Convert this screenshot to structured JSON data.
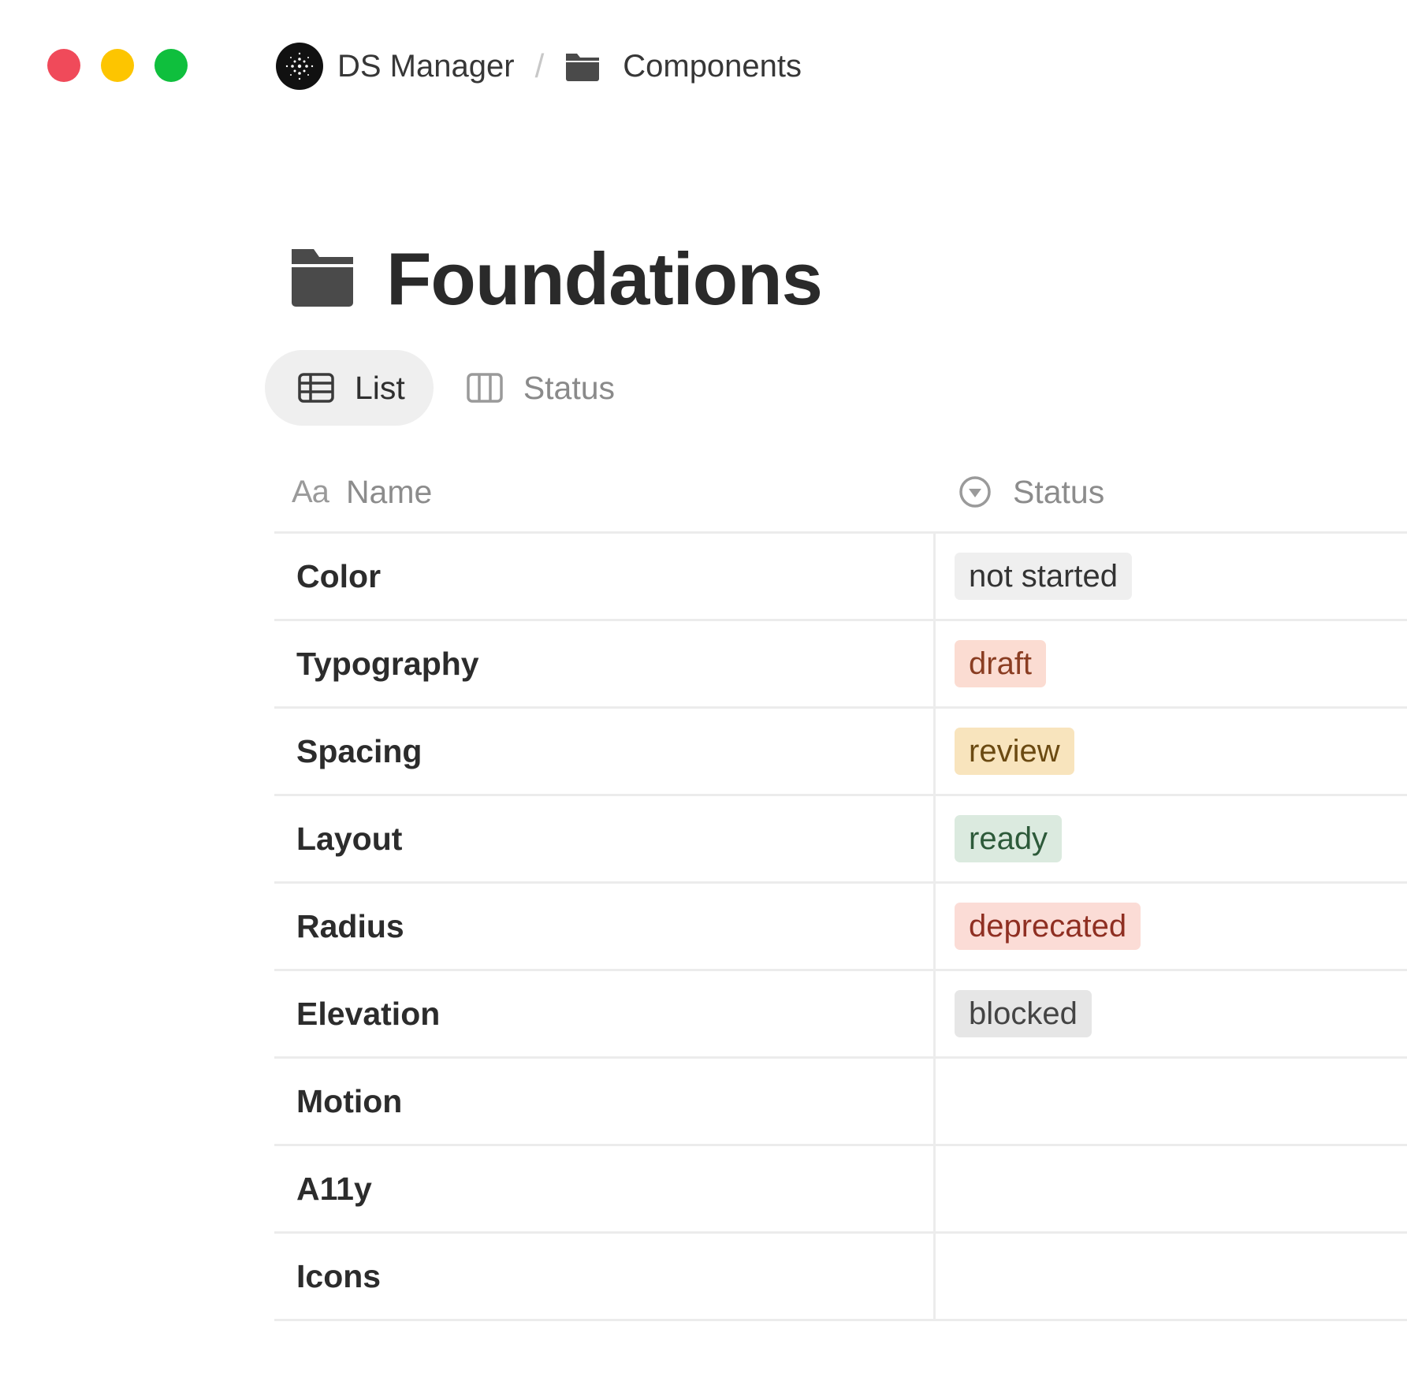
{
  "window_controls": {
    "close_color": "#f04a5a",
    "minimize_color": "#fdc500",
    "maximize_color": "#0fbf3d"
  },
  "breadcrumb": {
    "workspace": "DS Manager",
    "separator": "/",
    "page": "Components"
  },
  "page": {
    "title": "Foundations"
  },
  "tabs": [
    {
      "label": "List",
      "icon": "table-icon",
      "active": true
    },
    {
      "label": "Status",
      "icon": "board-icon",
      "active": false
    }
  ],
  "table": {
    "columns": [
      {
        "label": "Name",
        "icon": "text-property-icon"
      },
      {
        "label": "Status",
        "icon": "select-property-icon"
      }
    ],
    "rows": [
      {
        "name": "Color",
        "status": "not started",
        "status_bg": "#efefef",
        "status_fg": "#333333"
      },
      {
        "name": "Typography",
        "status": "draft",
        "status_bg": "#fbdcd2",
        "status_fg": "#8a3d22"
      },
      {
        "name": "Spacing",
        "status": "review",
        "status_bg": "#f8e4bd",
        "status_fg": "#6b4a12"
      },
      {
        "name": "Layout",
        "status": "ready",
        "status_bg": "#dbeadf",
        "status_fg": "#2d5a3a"
      },
      {
        "name": "Radius",
        "status": "deprecated",
        "status_bg": "#fbdcd6",
        "status_fg": "#8f2f22"
      },
      {
        "name": "Elevation",
        "status": "blocked",
        "status_bg": "#e6e6e6",
        "status_fg": "#444444"
      },
      {
        "name": "Motion",
        "status": "",
        "status_bg": "",
        "status_fg": ""
      },
      {
        "name": "A11y",
        "status": "",
        "status_bg": "",
        "status_fg": ""
      },
      {
        "name": "Icons",
        "status": "",
        "status_bg": "",
        "status_fg": ""
      }
    ]
  }
}
